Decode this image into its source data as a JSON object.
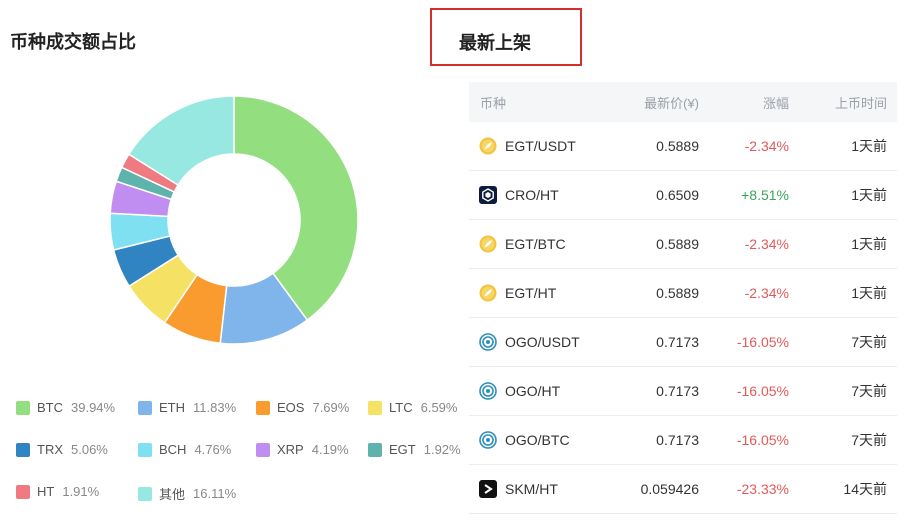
{
  "left_title": "币种成交额占比",
  "right_tab": "最新上架",
  "chart_data": {
    "type": "pie",
    "donut": true,
    "legend_position": "bottom",
    "slices": [
      {
        "name": "BTC",
        "label": "39.94%",
        "value": 39.94,
        "color": "#93df80"
      },
      {
        "name": "ETH",
        "label": "11.83%",
        "value": 11.83,
        "color": "#7fb5ea"
      },
      {
        "name": "EOS",
        "label": "7.69%",
        "value": 7.69,
        "color": "#f99b2e"
      },
      {
        "name": "LTC",
        "label": "6.59%",
        "value": 6.59,
        "color": "#f5e163"
      },
      {
        "name": "TRX",
        "label": "5.06%",
        "value": 5.06,
        "color": "#2f84c1"
      },
      {
        "name": "BCH",
        "label": "4.76%",
        "value": 4.76,
        "color": "#7fe0f2"
      },
      {
        "name": "XRP",
        "label": "4.19%",
        "value": 4.19,
        "color": "#c08ef0"
      },
      {
        "name": "EGT",
        "label": "1.92%",
        "value": 1.92,
        "color": "#5eb4ad"
      },
      {
        "name": "HT",
        "label": "1.91%",
        "value": 1.91,
        "color": "#ef7a82"
      },
      {
        "name": "其他",
        "label": "16.11%",
        "value": 16.11,
        "color": "#97e8e0"
      }
    ]
  },
  "table": {
    "headers": [
      "币种",
      "最新价(¥)",
      "涨幅",
      "上币时间"
    ],
    "rows": [
      {
        "pair": "EGT/USDT",
        "price": "0.5889",
        "change": "-2.34%",
        "trend": "down",
        "time": "1天前",
        "icon": "egt-icon"
      },
      {
        "pair": "CRO/HT",
        "price": "0.6509",
        "change": "+8.51%",
        "trend": "up",
        "time": "1天前",
        "icon": "cro-icon"
      },
      {
        "pair": "EGT/BTC",
        "price": "0.5889",
        "change": "-2.34%",
        "trend": "down",
        "time": "1天前",
        "icon": "egt-icon"
      },
      {
        "pair": "EGT/HT",
        "price": "0.5889",
        "change": "-2.34%",
        "trend": "down",
        "time": "1天前",
        "icon": "egt-icon"
      },
      {
        "pair": "OGO/USDT",
        "price": "0.7173",
        "change": "-16.05%",
        "trend": "down",
        "time": "7天前",
        "icon": "ogo-icon"
      },
      {
        "pair": "OGO/HT",
        "price": "0.7173",
        "change": "-16.05%",
        "trend": "down",
        "time": "7天前",
        "icon": "ogo-icon"
      },
      {
        "pair": "OGO/BTC",
        "price": "0.7173",
        "change": "-16.05%",
        "trend": "down",
        "time": "7天前",
        "icon": "ogo-icon"
      },
      {
        "pair": "SKM/HT",
        "price": "0.059426",
        "change": "-23.33%",
        "trend": "down",
        "time": "14天前",
        "icon": "skm-icon"
      }
    ]
  }
}
